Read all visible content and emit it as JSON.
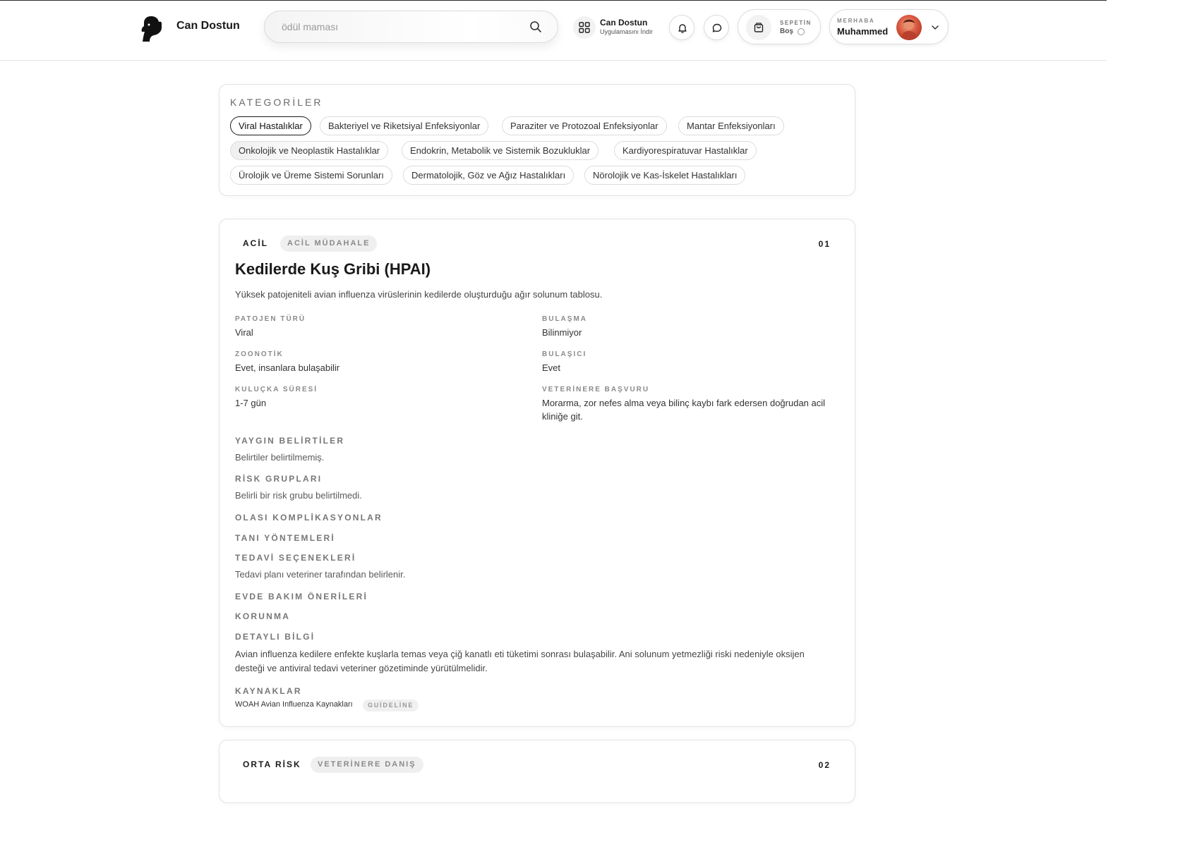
{
  "header": {
    "brand": "Can Dostun",
    "search": {
      "placeholder": "ödül maması"
    },
    "app": {
      "title": "Can Dostun",
      "subtitle": "Uygulamasını İndir"
    },
    "cart": {
      "label": "SEPETİN",
      "value": "Boş"
    },
    "user": {
      "greeting": "MERHABA",
      "name": "Muhammed"
    }
  },
  "categories": {
    "title": "KATEGORİLER",
    "items": [
      "Viral Hastalıklar",
      "Bakteriyel ve Riketsiyal Enfeksiyonlar",
      "Paraziter ve Protozoal Enfeksiyonlar",
      "Mantar Enfeksiyonları",
      "Onkolojik ve Neoplastik Hastalıklar",
      "Endokrin, Metabolik ve Sistemik Bozukluklar",
      "Kardiyorespiratuvar Hastalıklar",
      "Ürolojik ve Üreme Sistemi Sorunları",
      "Dermatolojik, Göz ve Ağız Hastalıkları",
      "Nörolojik ve Kas-İskelet Hastalıkları"
    ],
    "active": "Viral Hastalıklar"
  },
  "cards": [
    {
      "severity": "ACİL",
      "action": "ACİL MÜDAHALE",
      "number": "01",
      "title": "Kedilerde Kuş Gribi (HPAI)",
      "description": "Yüksek patojeniteli avian influenza virüslerinin kedilerde oluşturduğu ağır solunum tablosu.",
      "fields": {
        "pathogen": {
          "label": "PATOJEN TÜRÜ",
          "value": "Viral"
        },
        "transmission": {
          "label": "BULAŞMA",
          "value": "Bilinmiyor"
        },
        "zoonotic": {
          "label": "ZOONOTİK",
          "value": "Evet, insanlara bulaşabilir"
        },
        "contagious": {
          "label": "BULAŞICI",
          "value": "Evet"
        },
        "incubation": {
          "label": "KULUÇKA SÜRESİ",
          "value": "1-7 gün"
        },
        "vet": {
          "label": "VETERİNERE BAŞVURU",
          "value": "Morarma, zor nefes alma veya bilinç kaybı fark edersen doğrudan acil kliniğe git."
        }
      },
      "sections": {
        "symptoms": {
          "label": "YAYGIN BELİRTİLER",
          "value": "Belirtiler belirtilmemiş."
        },
        "risk": {
          "label": "RİSK GRUPLARI",
          "value": "Belirli bir risk grubu belirtilmedi."
        },
        "complications": {
          "label": "OLASI KOMPLİKASYONLAR"
        },
        "diagnosis": {
          "label": "TANI YÖNTEMLERİ"
        },
        "treatment": {
          "label": "TEDAVİ SEÇENEKLERİ",
          "value": "Tedavi planı veteriner tarafından belirlenir."
        },
        "homecare": {
          "label": "EVDE BAKIM ÖNERİLERİ"
        },
        "prevention": {
          "label": "KORUNMA"
        },
        "details": {
          "label": "DETAYLI BİLGİ",
          "value": "Avian influenza kedilere enfekte kuşlarla temas veya çiğ kanatlı eti tüketimi sonrası bulaşabilir. Ani solunum yetmezliği riski nedeniyle oksijen desteği ve antiviral tedavi veteriner gözetiminde yürütülmelidir."
        },
        "sources": {
          "label": "KAYNAKLAR",
          "name": "WOAH Avian Influenza Kaynakları",
          "tag": "GUİDELİNE"
        }
      }
    },
    {
      "severity": "ORTA RİSK",
      "action": "VETERİNERE DANIŞ",
      "number": "02"
    }
  ],
  "colors": {
    "primary_text": "#1a1a1a",
    "muted_label": "#8a8a8a",
    "border": "#e2e2e2",
    "pill_bg": "#efefef"
  }
}
